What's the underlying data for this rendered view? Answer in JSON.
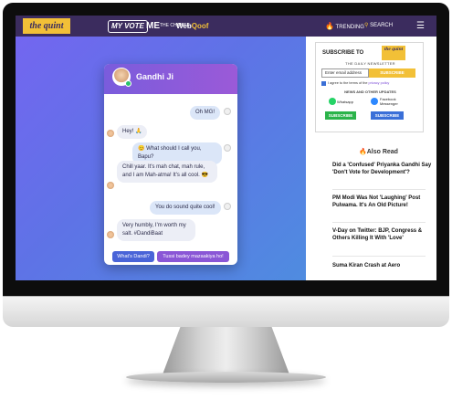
{
  "nav": {
    "logo": "the quint",
    "my_vote": "MY VOTE",
    "me_the_change": "ME",
    "me_the_change_sub": "THE CHANGE",
    "webqoof_a": "Web",
    "webqoof_b": "Qoof",
    "trending": "TRENDING",
    "search": "SEARCH",
    "menu": "☰"
  },
  "chat": {
    "name": "Gandhi Ji",
    "messages": [
      {
        "from": "user",
        "text": "Oh MG!"
      },
      {
        "from": "gandhi",
        "text": "Hey! 🙏"
      },
      {
        "from": "user",
        "text": "😊 What should I call you, Bapu?"
      },
      {
        "from": "gandhi",
        "text": "Chill yaar. It's mah chat, mah rule, and I am Mah-atma! It's all cool. 😎"
      },
      {
        "from": "user",
        "text": "You do sound quite cool!"
      },
      {
        "from": "gandhi",
        "text": "Very humbly, I'm worth my salt. #DandiBaat"
      }
    ],
    "buttons": {
      "dandi": "What's Dandi?",
      "tussi": "Tussi badey mazaakiya ho!"
    }
  },
  "subscribe": {
    "title": "SUBSCRIBE TO",
    "logo": "the quint",
    "newsletter": "THE DAILY NEWSLETTER",
    "email_placeholder": "Enter email address",
    "button": "SUBSCRIBE",
    "terms_a": "I agree to the terms of the ",
    "terms_b": "privacy policy",
    "updates": "NEWS AND OTHER UPDATES",
    "whatsapp": "Whatsapp",
    "facebook": "Facebook Messenger",
    "wa_button": "SUBSCRIBE",
    "fb_button": "SUBSCRIBE"
  },
  "also_read": {
    "title": "Also Read",
    "stories": [
      "Did a 'Confused' Priyanka Gandhi Say 'Don't Vote for Development'?",
      "PM Modi Was Not 'Laughing' Post Pulwama. It's An Old Picture!",
      "V-Day on Twitter: BJP, Congress & Others Killing It With 'Love'",
      "Suma Kiran Crash at Aero"
    ]
  },
  "colors": {
    "nav_bg": "#3b2c5e",
    "brand_yellow": "#f2c037",
    "chat_header": "#8a56d6",
    "hero_gradient_start": "#7366f0",
    "hero_gradient_end": "#4f8ce0"
  }
}
